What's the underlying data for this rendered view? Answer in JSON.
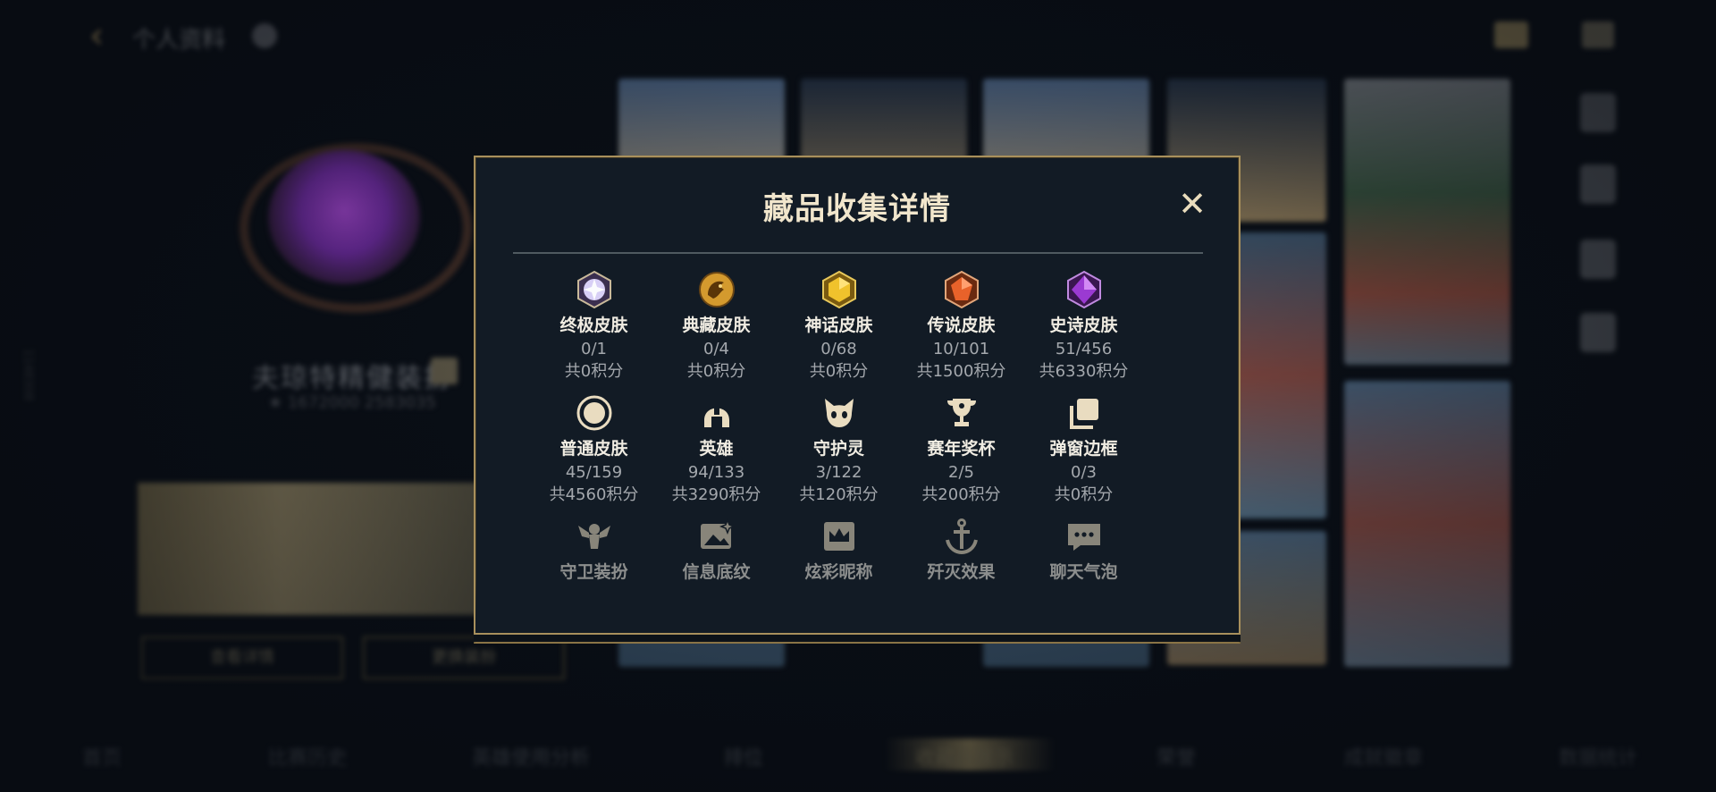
{
  "background": {
    "page_title": "个人资料",
    "player_name": "夫琼特精健装扮",
    "player_subtitle": "★ 1672000 2583035",
    "side_id": "1148308",
    "buttons": [
      "查看详情",
      "更换装扮"
    ],
    "bottom_tabs": [
      "首页",
      "比赛历史",
      "英雄使用分析",
      "排位",
      "收藏品展示",
      "荣誉",
      "成就徽章",
      "数据统计"
    ]
  },
  "modal": {
    "title": "藏品收集详情",
    "close_glyph": "✕",
    "categories": [
      {
        "label": "终极皮肤",
        "count": "0/1",
        "points": "共0积分",
        "icon": "ultimate-gem-icon"
      },
      {
        "label": "典藏皮肤",
        "count": "0/4",
        "points": "共0积分",
        "icon": "prestige-dragon-icon"
      },
      {
        "label": "神话皮肤",
        "count": "0/68",
        "points": "共0积分",
        "icon": "mythic-gem-icon"
      },
      {
        "label": "传说皮肤",
        "count": "10/101",
        "points": "共1500积分",
        "icon": "legendary-gem-icon"
      },
      {
        "label": "史诗皮肤",
        "count": "51/456",
        "points": "共6330积分",
        "icon": "epic-gem-icon"
      },
      {
        "label": "普通皮肤",
        "count": "45/159",
        "points": "共4560积分",
        "icon": "standard-circle-icon"
      },
      {
        "label": "英雄",
        "count": "94/133",
        "points": "共3290积分",
        "icon": "helmet-icon"
      },
      {
        "label": "守护灵",
        "count": "3/122",
        "points": "共120积分",
        "icon": "little-legend-icon"
      },
      {
        "label": "赛年奖杯",
        "count": "2/5",
        "points": "共200积分",
        "icon": "trophy-icon"
      },
      {
        "label": "弹窗边框",
        "count": "0/3",
        "points": "共0积分",
        "icon": "frame-stack-icon"
      },
      {
        "label": "守卫装扮",
        "icon": "ward-skin-icon"
      },
      {
        "label": "信息底纹",
        "icon": "banner-image-icon"
      },
      {
        "label": "炫彩昵称",
        "icon": "crown-nameplate-icon"
      },
      {
        "label": "歼灭效果",
        "icon": "anchor-icon"
      },
      {
        "label": "聊天气泡",
        "icon": "chat-bubble-icon"
      }
    ]
  },
  "colors": {
    "gold_accent": "#a8905c",
    "modal_bg": "#121b25",
    "title_text": "#f1e6cc"
  }
}
